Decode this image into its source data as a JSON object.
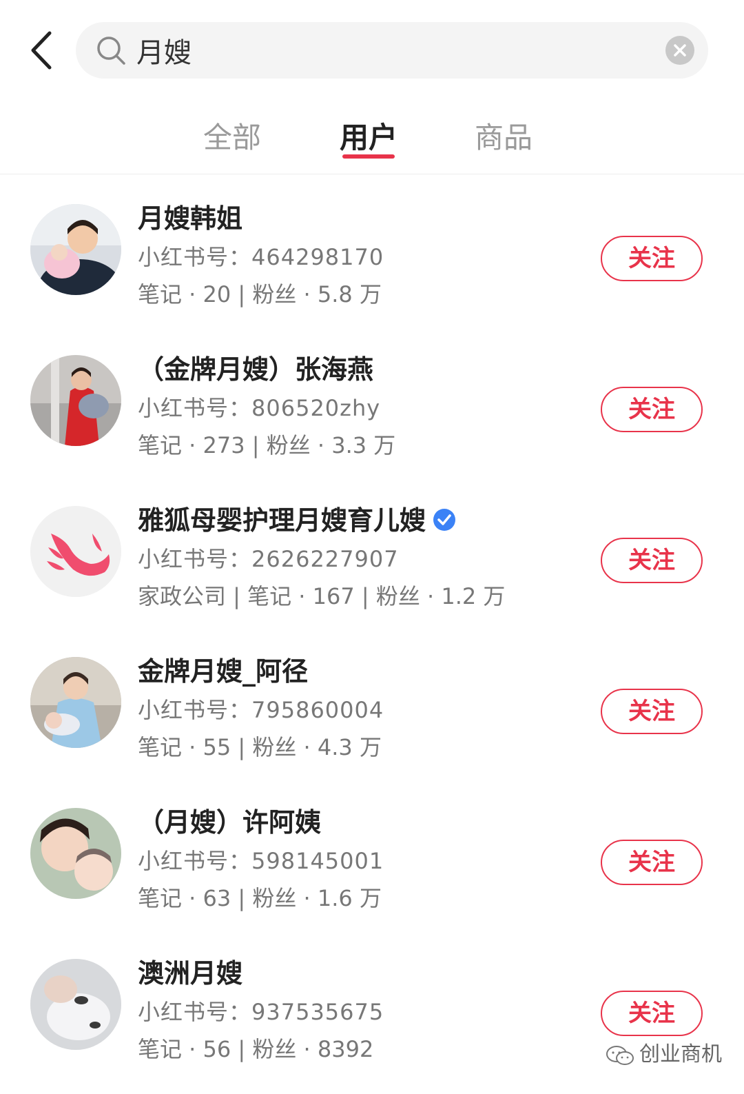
{
  "search": {
    "query": "月嫂"
  },
  "tabs": [
    {
      "label": "全部",
      "active": false
    },
    {
      "label": "用户",
      "active": true
    },
    {
      "label": "商品",
      "active": false
    }
  ],
  "accent_color": "#e8334a",
  "users": [
    {
      "name": "月嫂韩姐",
      "id_label": "小红书号：464298170",
      "stats": "笔记 · 20 | 粉丝 · 5.8 万",
      "verified": false,
      "follow_label": "关注"
    },
    {
      "name": "（金牌月嫂）张海燕",
      "id_label": "小红书号：806520zhy",
      "stats": "笔记 · 273 | 粉丝 · 3.3 万",
      "verified": false,
      "follow_label": "关注"
    },
    {
      "name": "雅狐母婴护理月嫂育儿嫂",
      "id_label": "小红书号：2626227907",
      "stats": "家政公司 | 笔记 · 167 | 粉丝 · 1.2 万",
      "verified": true,
      "follow_label": "关注"
    },
    {
      "name": "金牌月嫂_阿径",
      "id_label": "小红书号：795860004",
      "stats": "笔记 · 55 | 粉丝 · 4.3 万",
      "verified": false,
      "follow_label": "关注"
    },
    {
      "name": "（月嫂）许阿姨",
      "id_label": "小红书号：598145001",
      "stats": "笔记 · 63 | 粉丝 · 1.6 万",
      "verified": false,
      "follow_label": "关注"
    },
    {
      "name": "澳洲月嫂",
      "id_label": "小红书号：937535675",
      "stats": "笔记 · 56 | 粉丝 · 8392",
      "verified": false,
      "follow_label": "关注"
    }
  ],
  "watermark": {
    "text": "创业商机"
  }
}
